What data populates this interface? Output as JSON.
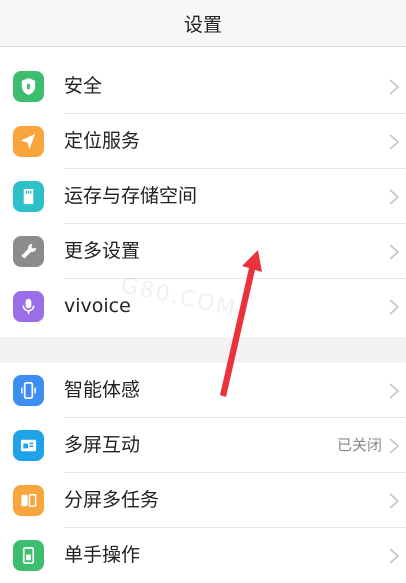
{
  "header": {
    "title": "设置"
  },
  "groups": [
    {
      "items": [
        {
          "label": "安全",
          "icon": "shield-icon",
          "color": "#3dbe6e"
        },
        {
          "label": "定位服务",
          "icon": "location-arrow-icon",
          "color": "#f7a53c"
        },
        {
          "label": "运存与存储空间",
          "icon": "storage-card-icon",
          "color": "#2ec0c9"
        },
        {
          "label": "更多设置",
          "icon": "wrench-icon",
          "color": "#8c8c8c"
        },
        {
          "label": "vivoice",
          "icon": "microphone-icon",
          "color": "#9a6ee6"
        }
      ]
    },
    {
      "items": [
        {
          "label": "智能体感",
          "icon": "motion-phone-icon",
          "color": "#3d8ef2"
        },
        {
          "label": "多屏互动",
          "value": "已关闭",
          "icon": "screen-cast-icon",
          "color": "#1fa3e8"
        },
        {
          "label": "分屏多任务",
          "icon": "split-screen-icon",
          "color": "#f7a53c"
        },
        {
          "label": "单手操作",
          "icon": "one-hand-icon",
          "color": "#3dbe6e"
        }
      ]
    }
  ],
  "watermark": "G80.COM",
  "colors": {
    "annotation_arrow": "#e8333a"
  }
}
